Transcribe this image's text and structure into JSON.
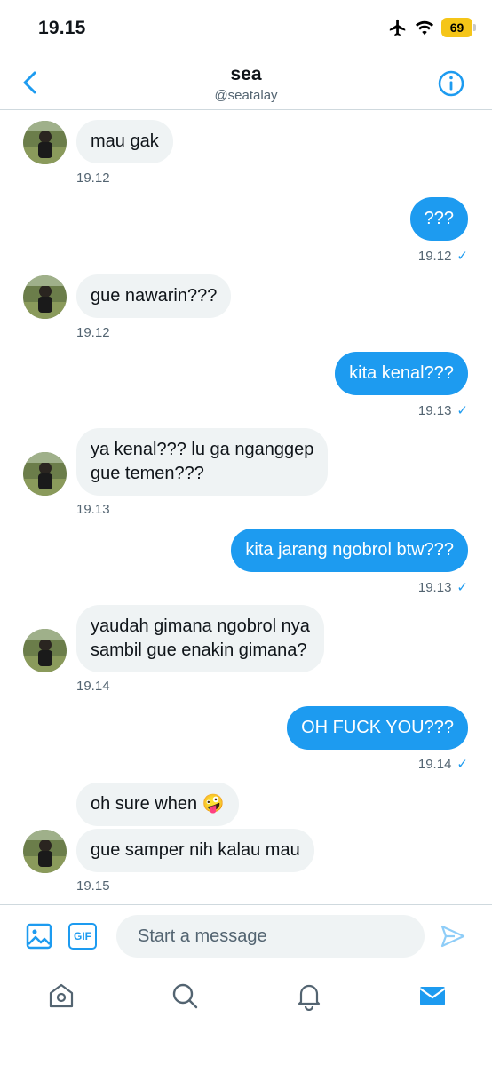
{
  "status_bar": {
    "time": "19.15",
    "battery": "69"
  },
  "header": {
    "name": "sea",
    "handle": "@seatalay"
  },
  "messages": [
    {
      "side": "in",
      "text": "mau gak",
      "time": "19.12"
    },
    {
      "side": "out",
      "text": "???",
      "time": "19.12"
    },
    {
      "side": "in",
      "text": "gue nawarin???",
      "time": "19.12"
    },
    {
      "side": "out",
      "text": "kita kenal???",
      "time": "19.13"
    },
    {
      "side": "in",
      "line1": "ya kenal??? lu ga nganggep",
      "line2": "gue temen???",
      "time": "19.13"
    },
    {
      "side": "out",
      "text": "kita jarang ngobrol btw???",
      "time": "19.13"
    },
    {
      "side": "in",
      "line1": "yaudah gimana ngobrol nya",
      "line2": "sambil gue enakin gimana?",
      "time": "19.14"
    },
    {
      "side": "out",
      "text": "OH FUCK YOU???",
      "time": "19.14"
    },
    {
      "side": "in",
      "text": "oh sure when 🤪"
    },
    {
      "side": "in",
      "text": "gue samper nih kalau mau",
      "time": "19.15"
    }
  ],
  "read_check": "✓",
  "composer": {
    "placeholder": "Start a message",
    "gif_label": "GIF"
  },
  "icons": {
    "back": "chevron-left-icon",
    "info": "info-icon",
    "media": "image-icon",
    "gif": "gif-icon",
    "send": "send-icon",
    "nav": [
      "home-icon",
      "search-icon",
      "bell-icon",
      "mail-icon"
    ]
  },
  "colors": {
    "accent": "#1d9bf0",
    "incoming_bubble": "#eff3f4",
    "battery": "#f5c518",
    "secondary_text": "#536471"
  }
}
